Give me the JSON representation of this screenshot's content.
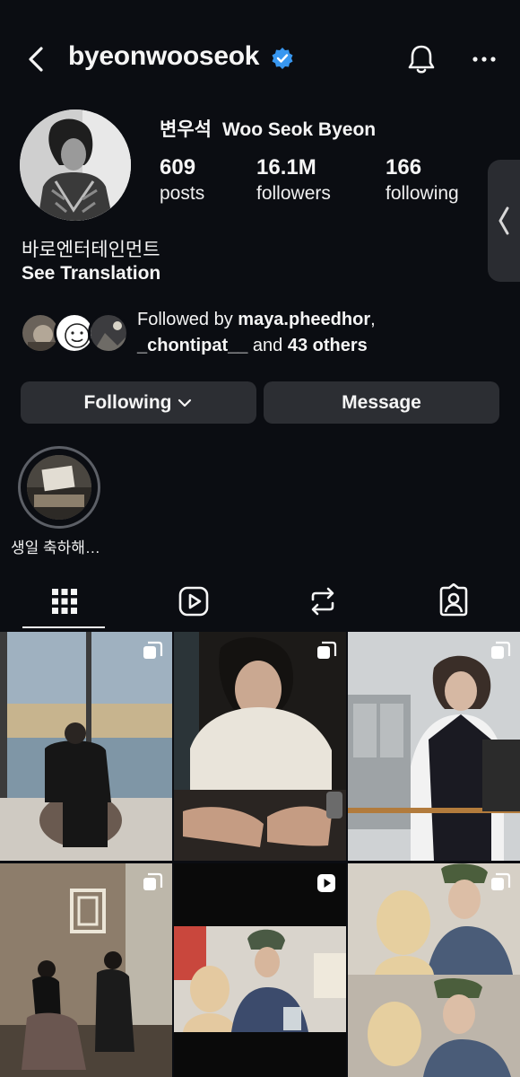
{
  "header": {
    "username": "byeonwooseok",
    "icons": [
      "back-arrow-icon",
      "verified-badge-icon",
      "bell-icon",
      "more-dots-icon"
    ]
  },
  "profile": {
    "name_kr": "변우석",
    "name_en": "Woo Seok Byeon",
    "stats": [
      {
        "value": "609",
        "label": "posts"
      },
      {
        "value": "16.1M",
        "label": "followers"
      },
      {
        "value": "166",
        "label": "following"
      }
    ],
    "bio": "바로엔터테인먼트",
    "see_translation": "See Translation",
    "followed_by": {
      "prefix": "Followed by ",
      "user1": "maya.pheedhor",
      "comma": ",",
      "user2": "_chontipat__",
      "and": " and ",
      "others": "43 others"
    }
  },
  "actions": {
    "following_label": "Following",
    "message_label": "Message"
  },
  "highlights": [
    {
      "label": "생일 축하해…"
    }
  ],
  "tabs": [
    "grid-icon",
    "reels-icon",
    "reposts-icon",
    "tagged-icon"
  ],
  "colors": {
    "background": "#0b0d12",
    "button": "#2c2e33",
    "verified": "#3897f0"
  },
  "posts": [
    {
      "badge": "carousel-icon"
    },
    {
      "badge": "carousel-icon"
    },
    {
      "badge": "carousel-icon"
    },
    {
      "badge": "carousel-icon"
    },
    {
      "badge": "reel-play-icon"
    },
    {
      "badge": "carousel-icon"
    }
  ]
}
